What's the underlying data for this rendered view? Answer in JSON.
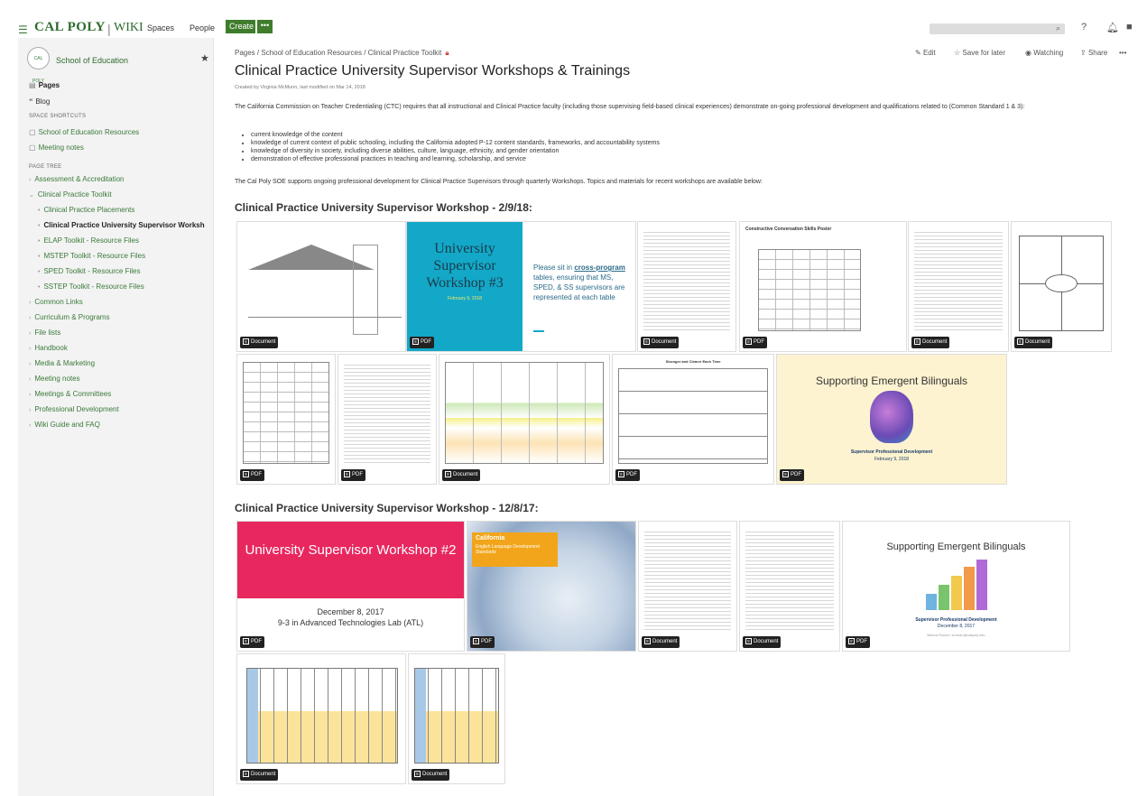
{
  "topnav": {
    "logo": "CAL POLY",
    "wiki": "WIKI",
    "spaces": "Spaces",
    "people": "People",
    "create": "Create",
    "more": "•••"
  },
  "sidebar": {
    "space_logo": "CAL POLY",
    "space_name": "School of Education",
    "pages": "Pages",
    "blog": "Blog",
    "shortcuts_header": "SPACE SHORTCUTS",
    "shortcuts": [
      "School of Education Resources",
      "Meeting notes"
    ],
    "tree_header": "PAGE TREE",
    "tree": [
      "Assessment & Accreditation",
      "Clinical Practice Toolkit",
      "Clinical Practice Placements",
      "Clinical Practice University Supervisor Worksh",
      "ELAP Toolkit - Resource Files",
      "MSTEP Toolkit - Resource Files",
      "SPED Toolkit - Resource Files",
      "SSTEP Toolkit - Resource Files",
      "Common Links",
      "Curriculum & Programs",
      "File lists",
      "Handbook",
      "Media & Marketing",
      "Meeting notes",
      "Meetings & Committees",
      "Professional Development",
      "Wiki Guide and FAQ"
    ]
  },
  "breadcrumb": "Pages / School of Education Resources / Clinical Practice Toolkit",
  "toolbar": {
    "edit": "Edit",
    "save_for_later": "Save for later",
    "watching": "Watching",
    "share": "Share",
    "more": "•••"
  },
  "title": "Clinical Practice University Supervisor Workshops & Trainings",
  "byline": "Created by Virginia McMunn, last modified on Mar 14, 2018",
  "intro": "The California Commission on Teacher Credentialing (CTC) requires that all instructional and Clinical Practice faculty (including those supervising field-based clinical experiences) demonstrate on-going professional development and qualifications related to (Common Standard 1 & 3):",
  "bullets": [
    "current knowledge of the content",
    "knowledge of current context of public schooling, including the California adopted P-12 content standards, frameworks, and accountability systems",
    "knowledge of diversity in society, including diverse abilities, culture, language, ethnicity, and gender orientation",
    "demonstration of effective professional practices in teaching and learning, scholarship, and service"
  ],
  "support_text": "The Cal Poly SOE supports ongoing professional development for Clinical Practice Supervisors through quarterly Workshops.  Topics and materials for recent workshops are available below:",
  "section1": "Clinical Practice University Supervisor Workshop - 2/9/18:",
  "section2": "Clinical Practice University Supervisor Workshop - 12/8/17:",
  "badges": {
    "document": "Document",
    "pdf": "PDF"
  },
  "thumbs": {
    "ws3_title": "University Supervisor Workshop #3",
    "ws3_date": "February 9, 2018",
    "ws3_note_a": "Please sit in ",
    "ws3_note_link": "cross-program",
    "ws3_note_b": " tables, ensuring that MS, SPED, & SS supervisors are represented at each table",
    "construct_title": "Constructive Conversation Skills Poster",
    "seq_title": "Stronger and Clearer Each Time",
    "seb1_title": "Supporting Emergent Bilinguals",
    "seb1_sub": "Supervisor Professional Development",
    "seb1_date": "February 9, 2018",
    "ws2_title": "University Supervisor Workshop #2",
    "ws2_date": "December 8, 2017",
    "ws2_place": "9-3 in Advanced Technologies Lab (ATL)",
    "elds_title": "California",
    "elds_sub": "English Language Development Standards",
    "seb2_title": "Supporting Emergent Bilinguals",
    "seb2_sub": "Supervisor Professional Development",
    "seb2_date": "December 8, 2017",
    "seb2_credit": "Briana Ronan / bronan@calpoly.edu"
  }
}
